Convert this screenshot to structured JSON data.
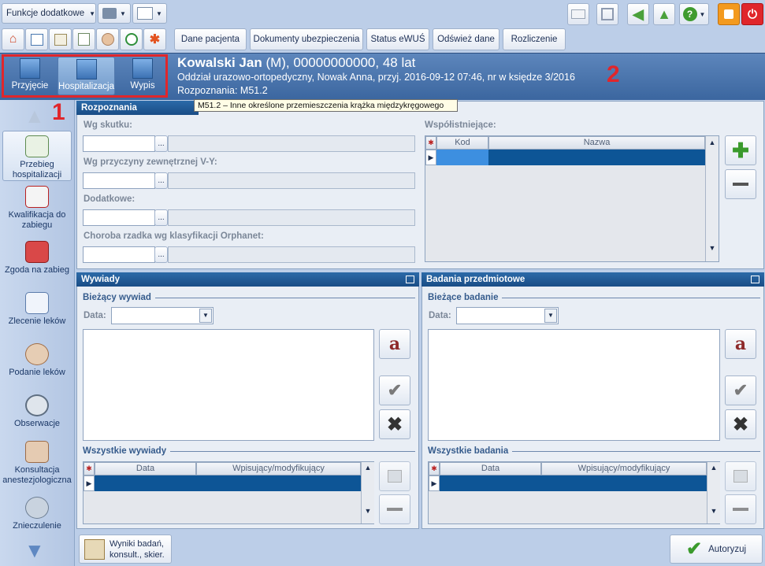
{
  "toolbar": {
    "funkcje_label": "Funkcje dodatkowe",
    "tabs": [
      "Dane pacjenta",
      "Dokumenty ubezpieczenia",
      "Status eWUŚ",
      "Odśwież dane",
      "Rozliczenie"
    ]
  },
  "modes": {
    "przyjecie": "Przyjęcie",
    "hospitalizacja": "Hospitalizacja",
    "wypis": "Wypis"
  },
  "markers": {
    "one": "1",
    "two": "2"
  },
  "patient": {
    "name": "Kowalski Jan",
    "details": " (M), 00000000000, 48 lat",
    "line2": "Oddział urazowo-ortopedyczny, Nowak Anna, przyj. 2016-09-12 07:46, nr w księdze 3/2016",
    "line3": "Rozpoznania: M51.2"
  },
  "tooltip": "M51.2 – Inne określone przemieszczenia krążka międzykręgowego",
  "sidebar": {
    "items": [
      {
        "label": "Przebieg hospitalizacji"
      },
      {
        "label": "Kwalifikacja do zabiegu"
      },
      {
        "label": "Zgoda na zabieg"
      },
      {
        "label": "Zlecenie leków"
      },
      {
        "label": "Podanie leków"
      },
      {
        "label": "Obserwacje"
      },
      {
        "label": "Konsultacja anestezjologiczna"
      },
      {
        "label": "Znieczulenie"
      }
    ]
  },
  "rozpoznania": {
    "title": "Rozpoznania",
    "wg_skutku": "Wg skutku:",
    "wg_przyczyny": "Wg przyczyny zewnętrznej V-Y:",
    "dodatkowe": "Dodatkowe:",
    "orphanet": "Choroba rzadka wg klasyfikacji Orphanet:",
    "ellipsis": "...",
    "wspolistniejace": "Współistniejące:",
    "cols": [
      "Kod",
      "Nazwa"
    ]
  },
  "wywiady": {
    "title": "Wywiady",
    "biezacy": "Bieżący wywiad",
    "data_label": "Data:",
    "wszystkie": "Wszystkie wywiady",
    "cols": [
      "Data",
      "Wpisujący/modyfikujący"
    ]
  },
  "badania": {
    "title": "Badania przedmiotowe",
    "biezace": "Bieżące badanie",
    "data_label": "Data:",
    "wszystkie": "Wszystkie badania",
    "cols": [
      "Data",
      "Wpisujący/modyfikujący"
    ]
  },
  "bottom": {
    "wyniki": "Wyniki badań, konsult., skier.",
    "autoryzuj": "Autoryzuj"
  },
  "colors": {
    "accent": "#1a4d86",
    "highlight_red": "#e0262b",
    "selection": "#0d5596"
  }
}
